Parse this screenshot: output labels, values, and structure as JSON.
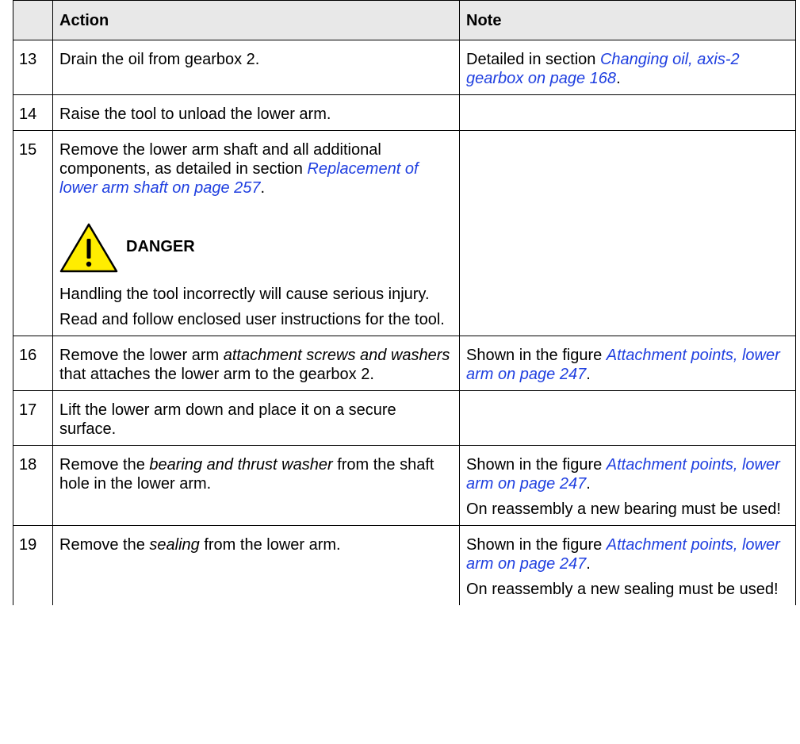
{
  "headers": {
    "step": "",
    "action": "Action",
    "note": "Note"
  },
  "rows": [
    {
      "num": "13",
      "action": [
        {
          "t": "Drain the oil from gearbox 2."
        }
      ],
      "note": [
        {
          "t": "Detailed in section "
        },
        {
          "t": "Changing oil, axis-2 gearbox on page 168",
          "link": true
        },
        {
          "t": "."
        }
      ],
      "note2": []
    },
    {
      "num": "14",
      "action": [
        {
          "t": "Raise the tool to unload the lower arm."
        }
      ],
      "note": [],
      "note2": []
    },
    {
      "num": "15",
      "action": [
        {
          "t": "Remove the lower arm shaft and all additional components, as detailed in section "
        },
        {
          "t": "Replacement of lower arm shaft on page 257",
          "link": true
        },
        {
          "t": "."
        }
      ],
      "danger": {
        "label": "DANGER",
        "icon": "warning-triangle-icon",
        "icon_fill": "#ffed00",
        "paragraphs": [
          "Handling the tool incorrectly will cause serious injury.",
          "Read and follow enclosed user instructions for the tool."
        ]
      },
      "note": [],
      "note2": []
    },
    {
      "num": "16",
      "action": [
        {
          "t": "Remove the lower arm "
        },
        {
          "t": "attachment screws and washers",
          "i": true
        },
        {
          "t": " that attaches the lower arm to the gearbox 2."
        }
      ],
      "note": [
        {
          "t": "Shown in the figure "
        },
        {
          "t": "Attachment points, lower arm on page 247",
          "link": true
        },
        {
          "t": "."
        }
      ],
      "note2": []
    },
    {
      "num": "17",
      "action": [
        {
          "t": "Lift the lower arm down and place it on a secure surface."
        }
      ],
      "note": [],
      "note2": []
    },
    {
      "num": "18",
      "action": [
        {
          "t": "Remove the "
        },
        {
          "t": "bearing and thrust washer",
          "i": true
        },
        {
          "t": "  from the shaft hole in the lower arm."
        }
      ],
      "note": [
        {
          "t": "Shown in the figure "
        },
        {
          "t": "Attachment points, lower arm on page 247",
          "link": true
        },
        {
          "t": "."
        }
      ],
      "note2": [
        {
          "t": "On reassembly a new bearing must be used!"
        }
      ]
    },
    {
      "num": "19",
      "action": [
        {
          "t": "Remove the "
        },
        {
          "t": "sealing",
          "i": true
        },
        {
          "t": " from the lower arm."
        }
      ],
      "note": [
        {
          "t": "Shown in the figure "
        },
        {
          "t": "Attachment points, lower arm on page 247",
          "link": true
        },
        {
          "t": "."
        }
      ],
      "note2": [
        {
          "t": "On reassembly a new sealing must be used!"
        }
      ]
    }
  ],
  "colors": {
    "header_bg": "#e8e8e8",
    "link": "#1f3fe0",
    "border": "#000000"
  }
}
